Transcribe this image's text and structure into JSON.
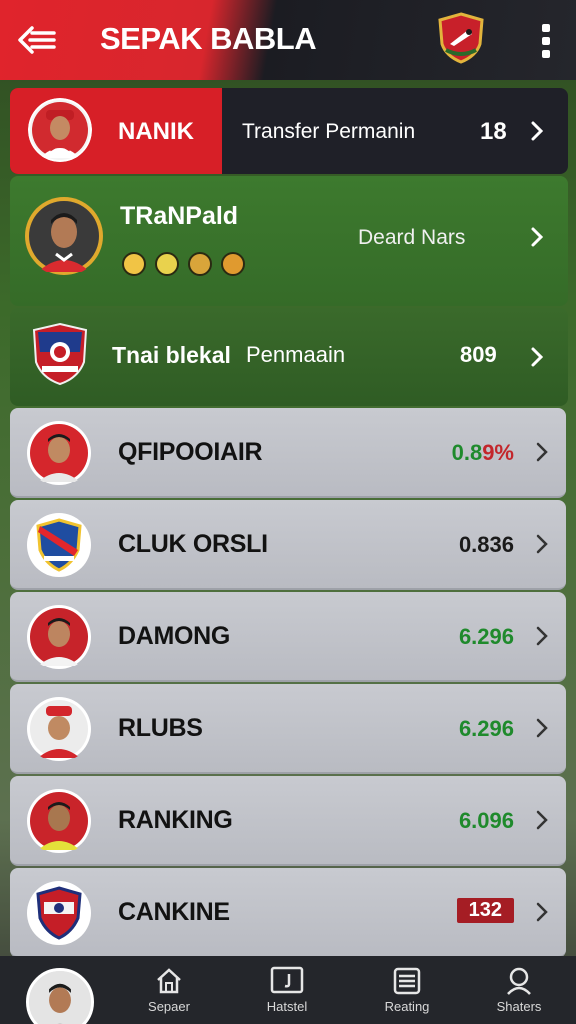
{
  "header": {
    "title": "SEPAK BABLA",
    "back_icon": "back-arrow-icon",
    "menu_icon": "more-vertical-icon"
  },
  "featured": [
    {
      "name": "NANIK",
      "label": "Transfer Permanin",
      "value": "18"
    },
    {
      "name": "TRaNPald",
      "status": "Deard Nars"
    },
    {
      "name": "Tnai blekal",
      "label": "Penmaain",
      "value": "809"
    }
  ],
  "list": {
    "items": [
      {
        "name": "QFIPOOIAIR",
        "value": "0.89%",
        "style": "green-red"
      },
      {
        "name": "CLUK ORSLI",
        "value": "0.836",
        "style": "dark"
      },
      {
        "name": "DAMONG",
        "value": "6.296",
        "style": "green"
      },
      {
        "name": "RLUBS",
        "value": "6.296",
        "style": "green"
      },
      {
        "name": "RANKING",
        "value": "6.096",
        "style": "green"
      },
      {
        "name": "CANKINE",
        "value": "132",
        "style": "badge"
      }
    ]
  },
  "bottom_nav": {
    "items": [
      {
        "label": "Sepaer",
        "icon": "home-icon"
      },
      {
        "label": "Hatstel",
        "icon": "media-icon"
      },
      {
        "label": "Reating",
        "icon": "list-icon"
      },
      {
        "label": "Shaters",
        "icon": "search-icon"
      }
    ]
  },
  "colors": {
    "accent_red": "#d71f27",
    "green": "#1f8a2c",
    "dark_bar": "#1f2028"
  }
}
